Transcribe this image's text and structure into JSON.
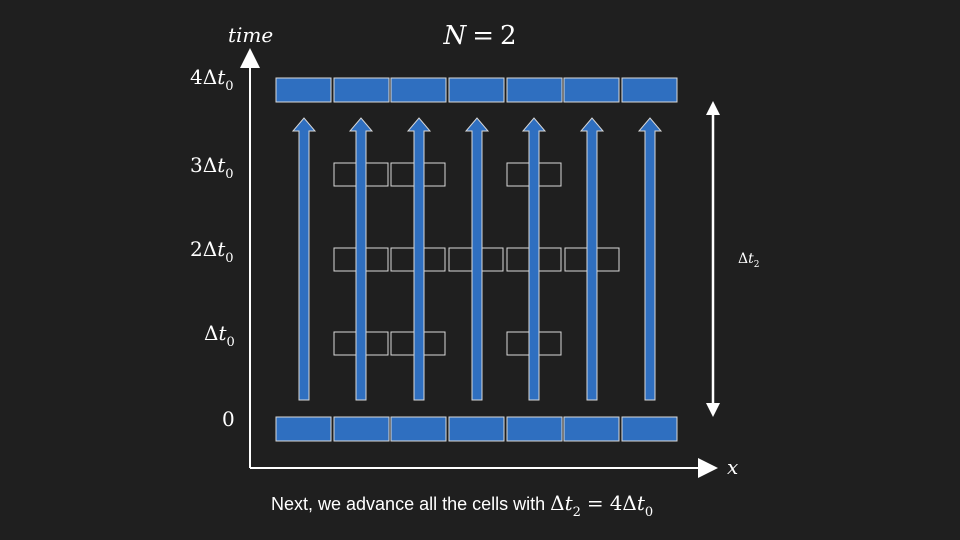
{
  "title": {
    "var": "N",
    "eq": "=",
    "val": "2"
  },
  "axes": {
    "y_label": "time",
    "x_label": "x"
  },
  "y_ticks": [
    {
      "coef": "4",
      "sym": "Δ",
      "var": "t",
      "sub": "0"
    },
    {
      "coef": "3",
      "sym": "Δ",
      "var": "t",
      "sub": "0"
    },
    {
      "coef": "2",
      "sym": "Δ",
      "var": "t",
      "sub": "0"
    },
    {
      "coef": "",
      "sym": "Δ",
      "var": "t",
      "sub": "0"
    },
    {
      "plain": "0"
    }
  ],
  "timestep_label": {
    "sym": "Δ",
    "var": "t",
    "sub": "2"
  },
  "caption": {
    "text": "Next, we advance all the cells with ",
    "math": {
      "lhs_sym": "Δ",
      "lhs_var": "t",
      "lhs_sub": "2",
      "eq": "=",
      "rhs_coef": "4",
      "rhs_sym": "Δ",
      "rhs_var": "t",
      "rhs_sub": "0"
    }
  },
  "grid": {
    "columns": 7,
    "levels": [
      "0",
      "1",
      "2",
      "3",
      "4"
    ],
    "outline_cells": {
      "level_1": [
        1,
        2,
        4
      ],
      "level_2": [
        1,
        2,
        3,
        4,
        5
      ],
      "level_3": [
        1,
        2,
        4
      ]
    },
    "filled_rows": [
      "level_0",
      "level_4"
    ],
    "arrows": "every column, level 0 to level 4"
  },
  "colors": {
    "background": "#1f1f1f",
    "cell_fill": "#2f6fc0",
    "cell_stroke": "#d8d8d8",
    "axis": "#ffffff",
    "text": "#ffffff"
  }
}
